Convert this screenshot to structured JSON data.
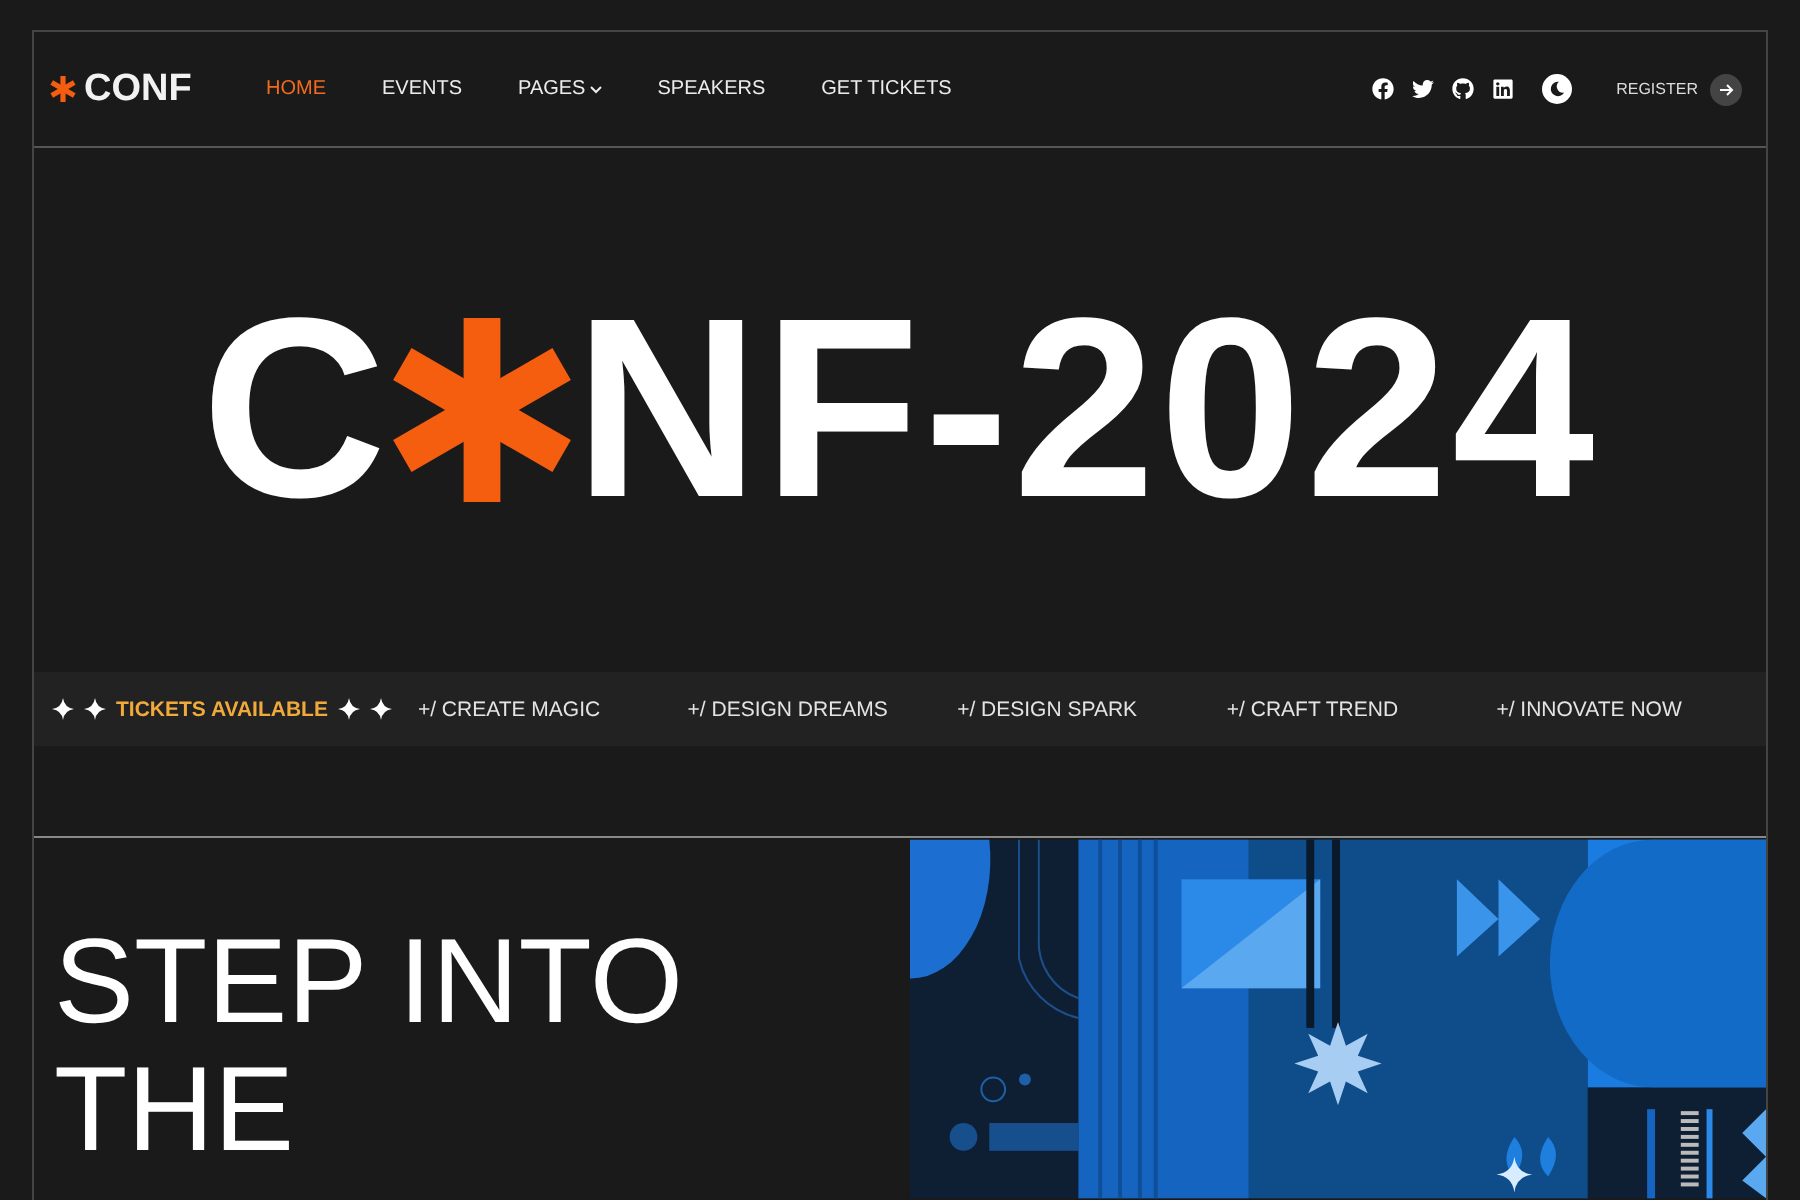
{
  "header": {
    "logo": "CONF",
    "nav": [
      {
        "label": "HOME",
        "selected": true,
        "dropdown": false
      },
      {
        "label": "EVENTS",
        "selected": false,
        "dropdown": false
      },
      {
        "label": "PAGES",
        "selected": false,
        "dropdown": true
      },
      {
        "label": "SPEAKERS",
        "selected": false,
        "dropdown": false
      },
      {
        "label": "GET TICKETS",
        "selected": false,
        "dropdown": false
      }
    ],
    "social": [
      {
        "kind": "facebook"
      },
      {
        "kind": "twitter"
      },
      {
        "kind": "github"
      },
      {
        "kind": "linkedin"
      }
    ],
    "register": "REGISTER"
  },
  "hero": {
    "title_start": "C",
    "title_end": "NF-2024"
  },
  "ticker": {
    "highlight": "TICKETS AVAILABLE",
    "items": [
      "+/ CREATE MAGIC",
      "+/ DESIGN DREAMS",
      "+/ DESIGN SPARK",
      "+/ CRAFT TREND",
      "+/ INNOVATE NOW"
    ]
  },
  "intro": {
    "heading_lines": [
      "STEP INTO",
      "THE"
    ]
  }
}
